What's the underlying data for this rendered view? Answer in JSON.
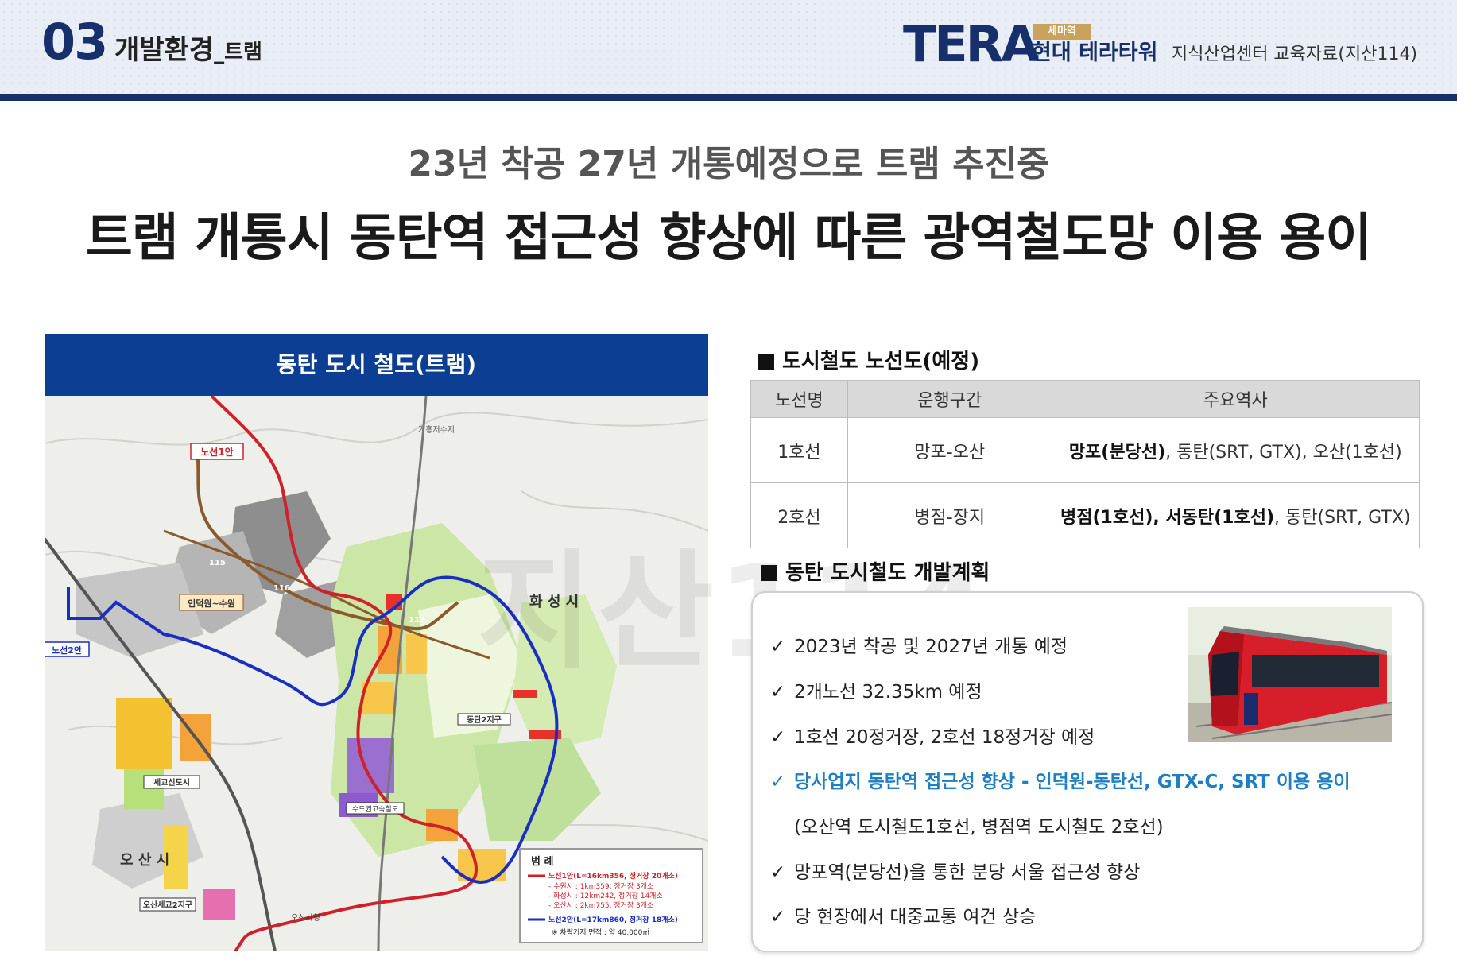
{
  "header": {
    "section_number": "03",
    "section_title": "개발환경",
    "section_subtitle": "_트램",
    "brand_logo": "TERA",
    "brand_badge": "세마역",
    "brand_name": "현대 테라타워",
    "brand_desc": "지식산업센터 교육자료(지산114)"
  },
  "headline": {
    "sub": "23년 착공 27년 개통예정으로 트램 추진중",
    "main": "트램 개통시 동탄역 접근성 향상에 따른 광역철도망 이용 용이"
  },
  "map_panel": {
    "title": "동탄 도시 철도(트램)",
    "labels": {
      "reservoir": "기흥저수지",
      "line1": "노선1안",
      "line2": "노선2안",
      "indeokwon": "인덕원~수원",
      "dongtan2": "동탄2지구",
      "saegyo": "세교신도시",
      "sudogwon": "수도권고속철도",
      "osan_saegyo2": "오산세교2지구",
      "osan_city_hall": "오산시청",
      "hwaseong": "화 성 시",
      "osan": "오 산 시",
      "road_115": "115",
      "road_116": "116",
      "road_117": "117"
    },
    "legend": {
      "title": "범 례",
      "items": [
        "노선1안(L=16km356, 정거장 20개소)",
        "- 수원시 : 1km359, 정거장 3개소",
        "- 화성시 : 12km242, 정거장 14개소",
        "- 오산시 : 2km755, 정거장 3개소",
        "노선2안(L=17km860, 정거장 18개소)",
        "※ 차량기지 면적 : 약 40,000㎡"
      ]
    },
    "colors": {
      "line1": "#d0202a",
      "line2": "#1a2fbf",
      "railway": "#8a5a2b"
    }
  },
  "watermark": "지산114",
  "route_section": {
    "title": "도시철도 노선도(예정)",
    "headers": [
      "노선명",
      "운행구간",
      "주요역사"
    ],
    "rows": [
      {
        "name": "1호선",
        "section": "망포-오산",
        "stations_bold": "망포(분당선)",
        "stations_rest": ", 동탄(SRT, GTX), 오산(1호선)"
      },
      {
        "name": "2호선",
        "section": "병점-장지",
        "stations_bold": "병점(1호선), 서동탄(1호선)",
        "stations_rest": ", 동탄(SRT, GTX)"
      }
    ]
  },
  "plan_section": {
    "title": "동탄 도시철도 개발계획",
    "check": "✓",
    "items": [
      "2023년 착공 및 2027년 개통 예정",
      "2개노선 32.35km 예정",
      "1호선 20정거장, 2호선 18정거장 예정",
      "당사업지 동탄역 접근성 향상 - 인덕원-동탄선, GTX-C, SRT 이용 용이",
      "(오산역 도시철도1호선, 병점역 도시철도 2호선)",
      "망포역(분당선)을 통한 분당 서울 접근성 향상",
      "당 현장에서 대중교통 여건 상승"
    ],
    "highlight_color": "#1f7fc1"
  }
}
